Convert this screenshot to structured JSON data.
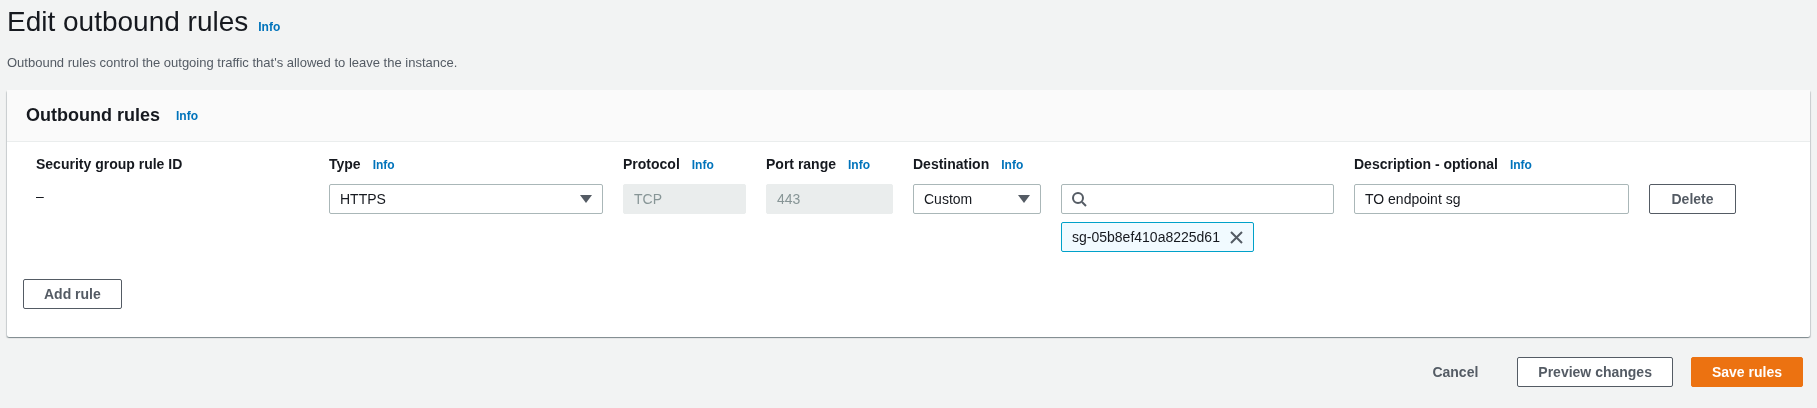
{
  "page": {
    "title": "Edit outbound rules",
    "info": "Info",
    "description": "Outbound rules control the outgoing traffic that's allowed to leave the instance."
  },
  "panel": {
    "title": "Outbound rules",
    "info": "Info",
    "rules": [
      {
        "fields": [
          {
            "kind": "text",
            "header": {
              "label": "Security group rule ID"
            },
            "value": "–"
          },
          {
            "kind": "select",
            "header": {
              "label": "Type",
              "info": "Info"
            },
            "value": "HTTPS"
          },
          {
            "kind": "readonly",
            "header": {
              "label": "Protocol",
              "info": "Info"
            },
            "value": "TCP",
            "disabled": true
          },
          {
            "kind": "readonly",
            "header": {
              "label": "Port range",
              "info": "Info"
            },
            "value": "443",
            "disabled": true
          },
          {
            "kind": "select",
            "header": {
              "label": "Destination",
              "info": "Info"
            },
            "value": "Custom"
          },
          {
            "kind": "search",
            "tokens": [
              "sg-05b8ef410a8225d61"
            ]
          },
          {
            "kind": "input",
            "header": {
              "label": "Description - optional",
              "info": "Info"
            },
            "value": "TO endpoint sg"
          },
          {
            "kind": "button",
            "value": "Delete"
          }
        ]
      }
    ],
    "add_rule": "Add rule"
  },
  "footer": [
    {
      "kind": "link",
      "label": "Cancel"
    },
    {
      "kind": "secondary",
      "label": "Preview changes"
    },
    {
      "kind": "primary",
      "label": "Save rules"
    }
  ]
}
